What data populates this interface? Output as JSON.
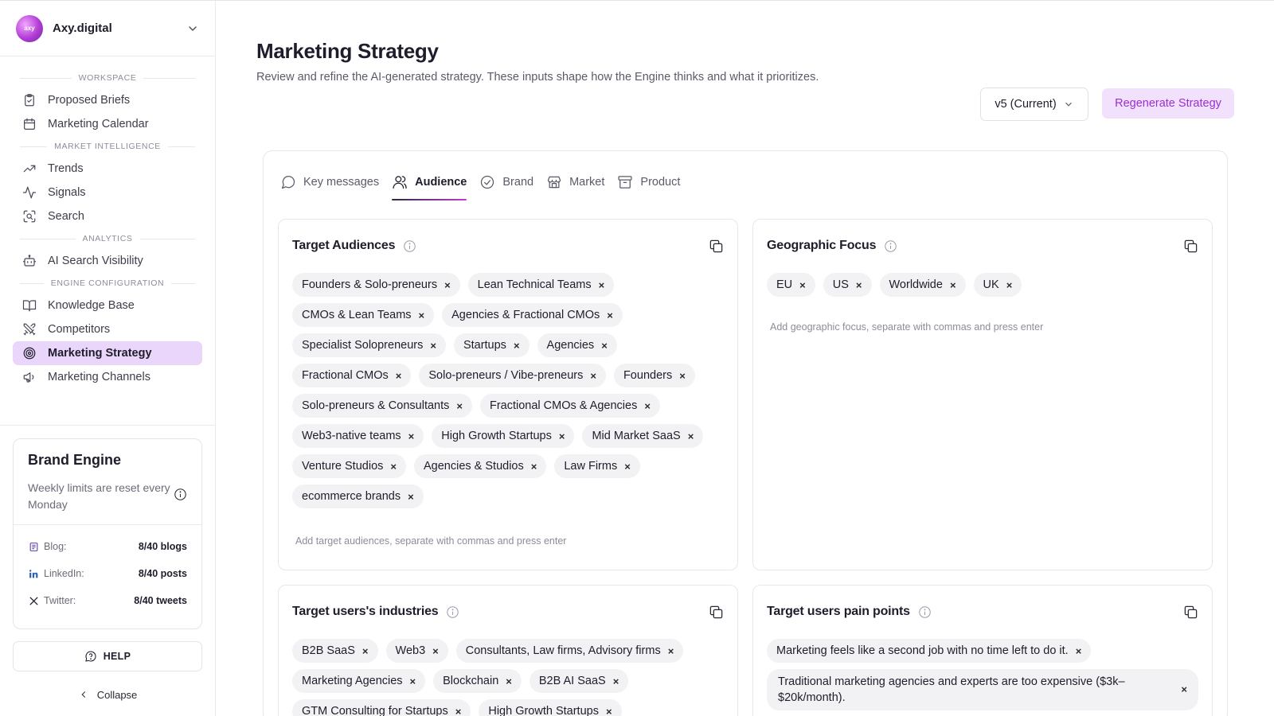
{
  "org": {
    "name": "Axy.digital",
    "avatar_text": "axy"
  },
  "nav": {
    "sections": [
      {
        "label": "Workspace",
        "items": [
          {
            "label": "Proposed Briefs",
            "icon": "clipboard-icon"
          },
          {
            "label": "Marketing Calendar",
            "icon": "calendar-icon"
          }
        ]
      },
      {
        "label": "Market Intelligence",
        "items": [
          {
            "label": "Trends",
            "icon": "trending-up-icon"
          },
          {
            "label": "Signals",
            "icon": "activity-icon"
          },
          {
            "label": "Search",
            "icon": "scan-search-icon"
          }
        ]
      },
      {
        "label": "Analytics",
        "items": [
          {
            "label": "AI Search Visibility",
            "icon": "bot-icon"
          }
        ]
      },
      {
        "label": "Engine Configuration",
        "items": [
          {
            "label": "Knowledge Base",
            "icon": "book-icon"
          },
          {
            "label": "Competitors",
            "icon": "swords-icon"
          },
          {
            "label": "Marketing Strategy",
            "icon": "target-icon",
            "active": true
          },
          {
            "label": "Marketing Channels",
            "icon": "megaphone-icon"
          }
        ]
      }
    ]
  },
  "engine": {
    "title": "Brand Engine",
    "note": "Weekly limits are reset every Monday",
    "limits": [
      {
        "label": "Blog:",
        "value": "8/40 blogs",
        "icon": "blog-icon"
      },
      {
        "label": "LinkedIn:",
        "value": "8/40 posts",
        "icon": "linkedin-icon"
      },
      {
        "label": "Twitter:",
        "value": "8/40 tweets",
        "icon": "x-twitter-icon"
      }
    ]
  },
  "help_label": "HELP",
  "collapse_label": "Collapse",
  "page": {
    "title": "Marketing Strategy",
    "subtitle": "Review and refine the AI-generated strategy. These inputs shape how the Engine thinks and what it prioritizes.",
    "version": "v5 (Current)",
    "regenerate_label": "Regenerate Strategy"
  },
  "tabs": [
    {
      "label": "Key messages",
      "icon": "message-circle-icon"
    },
    {
      "label": "Audience",
      "icon": "users-icon",
      "active": true
    },
    {
      "label": "Brand",
      "icon": "badge-check-icon"
    },
    {
      "label": "Market",
      "icon": "store-icon"
    },
    {
      "label": "Product",
      "icon": "archive-box-icon"
    }
  ],
  "cards": {
    "target_audiences": {
      "title": "Target Audiences",
      "chips": [
        "Founders & Solo-preneurs",
        "Lean Technical Teams",
        "CMOs & Lean Teams",
        "Agencies & Fractional CMOs",
        "Specialist Solopreneurs",
        "Startups",
        "Agencies",
        "Fractional CMOs",
        "Solo-preneurs / Vibe-preneurs",
        "Founders",
        "Solo-preneurs & Consultants",
        "Fractional CMOs & Agencies",
        "Web3-native teams",
        "High Growth Startups",
        "Mid Market SaaS",
        "Venture Studios",
        "Agencies & Studios",
        "Law Firms",
        "ecommerce brands"
      ],
      "hint": "Add target audiences, separate with commas and press enter"
    },
    "geographic_focus": {
      "title": "Geographic Focus",
      "chips": [
        "EU",
        "US",
        "Worldwide",
        "UK"
      ],
      "hint": "Add geographic focus, separate with commas and press enter"
    },
    "industries": {
      "title": "Target users's industries",
      "chips": [
        "B2B SaaS",
        "Web3",
        "Consultants, Law firms, Advisory firms",
        "Marketing Agencies",
        "Blockchain",
        "B2B AI SaaS",
        "GTM Consulting for Startups",
        "High Growth Startups"
      ]
    },
    "pain_points": {
      "title": "Target users pain points",
      "chips": [
        "Marketing feels like a second job with no time left to do it.",
        "Traditional marketing agencies and experts are too expensive ($3k–$20k/month)."
      ]
    }
  }
}
